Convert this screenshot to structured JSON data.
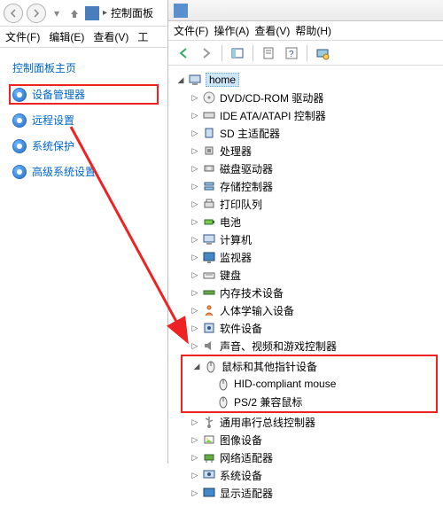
{
  "left": {
    "breadcrumb": "控制面板",
    "menu": {
      "file": "文件(F)",
      "edit": "编辑(E)",
      "view": "查看(V)",
      "tools": "工"
    },
    "home": "控制面板主页",
    "items": [
      {
        "label": "设备管理器"
      },
      {
        "label": "远程设置"
      },
      {
        "label": "系统保护"
      },
      {
        "label": "高级系统设置"
      }
    ]
  },
  "right": {
    "menu": {
      "file": "文件(F)",
      "action": "操作(A)",
      "view": "查看(V)",
      "help": "帮助(H)"
    },
    "root": "home",
    "nodes": [
      {
        "label": "DVD/CD-ROM 驱动器",
        "icon": "disc"
      },
      {
        "label": "IDE ATA/ATAPI 控制器",
        "icon": "ide"
      },
      {
        "label": "SD 主适配器",
        "icon": "sd"
      },
      {
        "label": "处理器",
        "icon": "cpu"
      },
      {
        "label": "磁盘驱动器",
        "icon": "disk"
      },
      {
        "label": "存储控制器",
        "icon": "storage"
      },
      {
        "label": "打印队列",
        "icon": "printer"
      },
      {
        "label": "电池",
        "icon": "battery"
      },
      {
        "label": "计算机",
        "icon": "computer"
      },
      {
        "label": "监视器",
        "icon": "monitor"
      },
      {
        "label": "键盘",
        "icon": "keyboard"
      },
      {
        "label": "内存技术设备",
        "icon": "memory"
      },
      {
        "label": "人体学输入设备",
        "icon": "hid"
      },
      {
        "label": "软件设备",
        "icon": "software"
      },
      {
        "label": "声音、视频和游戏控制器",
        "icon": "sound"
      }
    ],
    "mouse_group": {
      "label": "鼠标和其他指针设备",
      "children": [
        {
          "label": "HID-compliant mouse"
        },
        {
          "label": "PS/2 兼容鼠标"
        }
      ]
    },
    "nodes_after": [
      {
        "label": "通用串行总线控制器",
        "icon": "usb"
      },
      {
        "label": "图像设备",
        "icon": "image"
      },
      {
        "label": "网络适配器",
        "icon": "network"
      },
      {
        "label": "系统设备",
        "icon": "system"
      },
      {
        "label": "显示适配器",
        "icon": "display"
      }
    ]
  }
}
